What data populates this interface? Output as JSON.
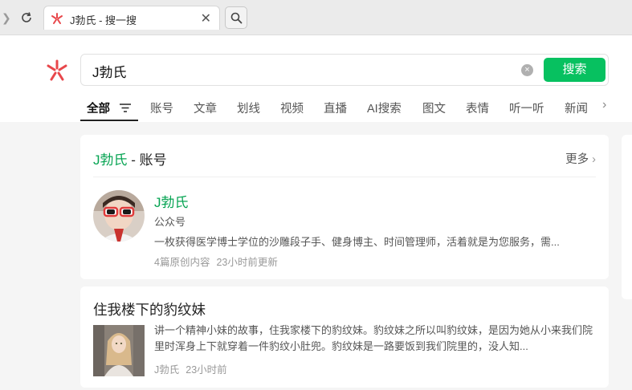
{
  "browser": {
    "tab_title": "J勃氏 - 搜一搜"
  },
  "search": {
    "query": "J勃氏",
    "button_label": "搜索",
    "clear_symbol": "×"
  },
  "nav": {
    "tabs": [
      {
        "label": "全部"
      },
      {
        "label": "账号"
      },
      {
        "label": "文章"
      },
      {
        "label": "划线"
      },
      {
        "label": "视频"
      },
      {
        "label": "直播"
      },
      {
        "label": "AI搜索"
      },
      {
        "label": "图文"
      },
      {
        "label": "表情"
      },
      {
        "label": "听一听"
      },
      {
        "label": "新闻"
      }
    ]
  },
  "account_card": {
    "header_keyword": "J勃氏",
    "header_suffix": " - 账号",
    "more_label": "更多",
    "name": "J勃氏",
    "type": "公众号",
    "description": "一枚获得医学博士学位的沙雕段子手、健身博主、时间管理师，活着就是为您服务，需...",
    "original_count": "4篇原创内容",
    "updated": "23小时前更新"
  },
  "article_card": {
    "title": "住我楼下的豹纹妹",
    "summary": "讲一个精神小妹的故事，住我家楼下的豹纹妹。豹纹妹之所以叫豹纹妹，是因为她从小来我们院里时浑身上下就穿着一件豹纹小肚兜。豹纹妹是一路要饭到我们院里的，没人知...",
    "source": "J勃氏",
    "time": "23小时前"
  },
  "colors": {
    "brand_green": "#07c160",
    "keyword_green": "#07a453",
    "logo_red": "#e8474b"
  }
}
